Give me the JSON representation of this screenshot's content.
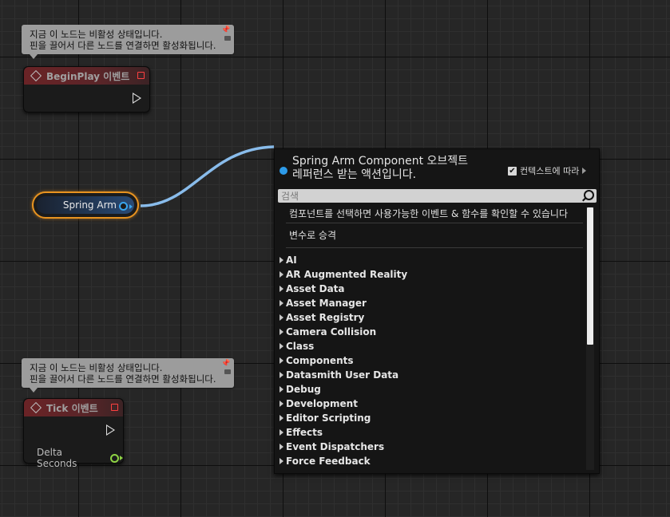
{
  "comments": [
    {
      "line1": "지금 이 노드는 비활성 상태입니다.",
      "line2": "핀을 끌어서 다른 노드를 연결하면 활성화됩니다."
    },
    {
      "line1": "지금 이 노드는 비활성 상태입니다.",
      "line2": "핀을 끌어서 다른 노드를 연결하면 활성화됩니다."
    }
  ],
  "nodes": {
    "begin_play": {
      "title": "BeginPlay 이벤트"
    },
    "tick": {
      "title": "Tick 이벤트",
      "pin_label": "Delta Seconds"
    },
    "spring_arm": {
      "label": "Spring Arm"
    }
  },
  "menu": {
    "title_line1": "Spring Arm Component 오브젝트",
    "title_line2": "레퍼런스 받는 액션입니다.",
    "context_label": "컨텍스트에 따라",
    "context_checked": true,
    "search_placeholder": "검색",
    "info_text": "컴포넌트를 선택하면 사용가능한 이벤트 & 함수를 확인할 수 있습니다",
    "convert_text": "변수로 승격",
    "categories": [
      "AI",
      "AR Augmented Reality",
      "Asset Data",
      "Asset Manager",
      "Asset Registry",
      "Camera Collision",
      "Class",
      "Components",
      "Datasmith User Data",
      "Debug",
      "Development",
      "Editor Scripting",
      "Effects",
      "Event Dispatchers",
      "Force Feedback"
    ]
  },
  "colors": {
    "wire": "#8ec4f5",
    "object_pin": "#39a5ee",
    "float_pin": "#8ed344",
    "selection": "#e89320",
    "event_header": "#6a2326"
  }
}
